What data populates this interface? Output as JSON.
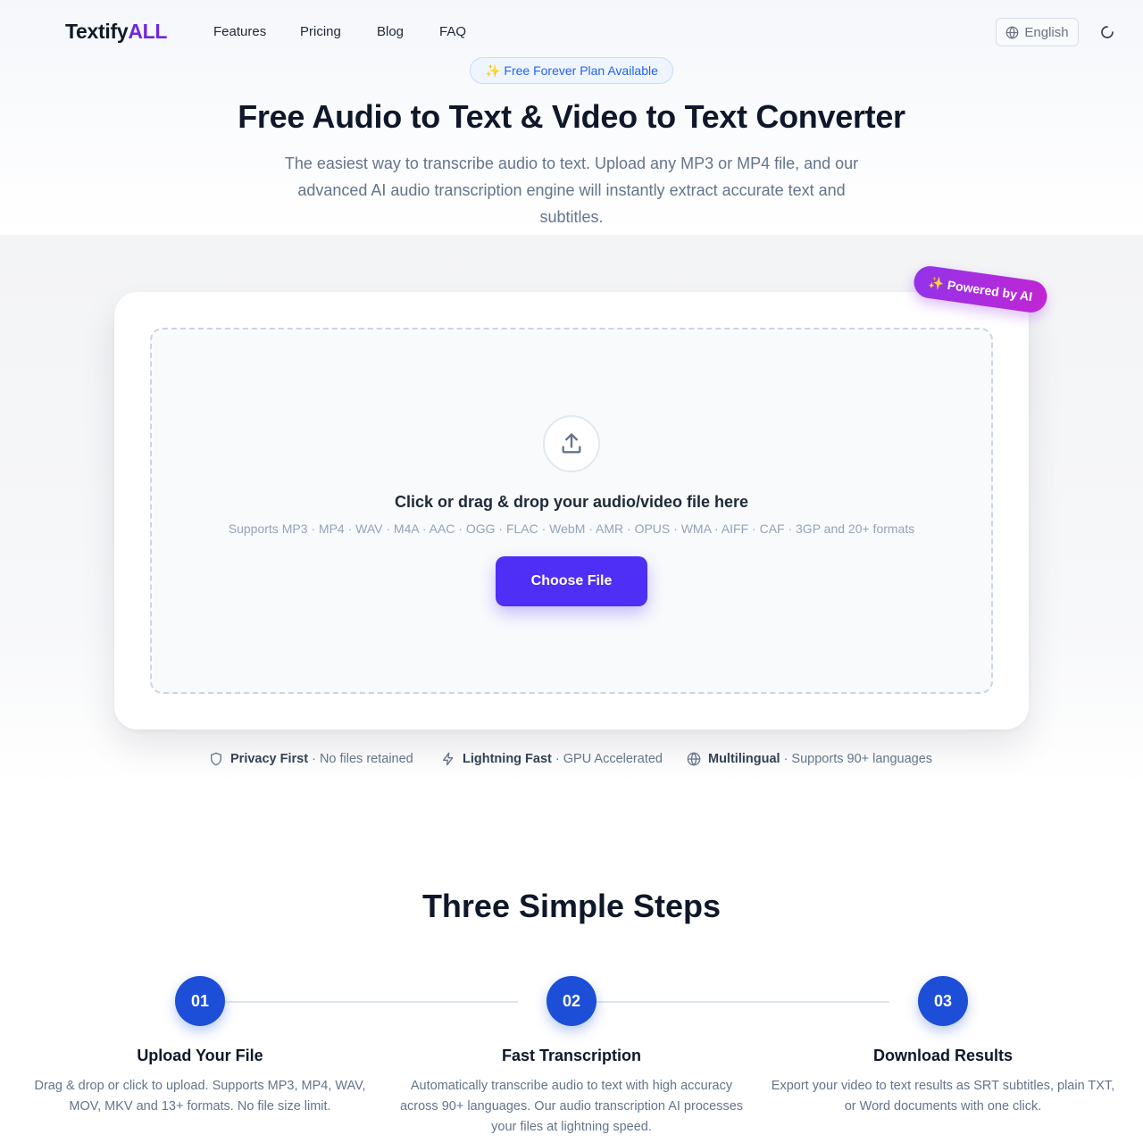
{
  "nav": {
    "logo_main": "Textify",
    "logo_accent": "ALL",
    "links": [
      "Features",
      "Pricing",
      "Blog",
      "FAQ"
    ],
    "language": "English"
  },
  "hero": {
    "badge": "✨ Free Forever Plan Available",
    "title": "Free Audio to Text & Video to Text Converter",
    "subtitle": "The easiest way to transcribe audio to text. Upload any MP3 or MP4 file, and our advanced AI audio transcription engine will instantly extract accurate text and subtitles."
  },
  "upload": {
    "ai_badge": "✨ Powered by AI",
    "title": "Click or drag & drop your audio/video file here",
    "formats": "Supports MP3 · MP4 · WAV · M4A · AAC · OGG · FLAC · WebM · AMR · OPUS · WMA · AIFF · CAF · 3GP and 20+ formats",
    "button": "Choose File"
  },
  "features": [
    {
      "icon": "shield-icon",
      "title": "Privacy First",
      "text": "· No files retained"
    },
    {
      "icon": "lightning-icon",
      "title": "Lightning Fast",
      "text": "· GPU Accelerated"
    },
    {
      "icon": "globe-icon",
      "title": "Multilingual",
      "text": "· Supports 90+ languages"
    }
  ],
  "steps": {
    "title": "Three Simple Steps",
    "items": [
      {
        "num": "01",
        "title": "Upload Your File",
        "desc": "Drag & drop or click to upload. Supports MP3, MP4, WAV, MOV, MKV and 13+ formats. No file size limit."
      },
      {
        "num": "02",
        "title": "Fast Transcription",
        "desc": "Automatically transcribe audio to text with high accuracy across 90+ languages. Our audio transcription AI processes your files at lightning speed."
      },
      {
        "num": "03",
        "title": "Download Results",
        "desc": "Export your video to text results as SRT subtitles, plain TXT, or Word documents with one click."
      }
    ]
  },
  "colors": {
    "primary": "#4f2ef5",
    "step_blue": "#1d4ed8",
    "logo_accent": "#6d28d9",
    "ai_badge_from": "#9333ea",
    "ai_badge_to": "#c026d3"
  }
}
